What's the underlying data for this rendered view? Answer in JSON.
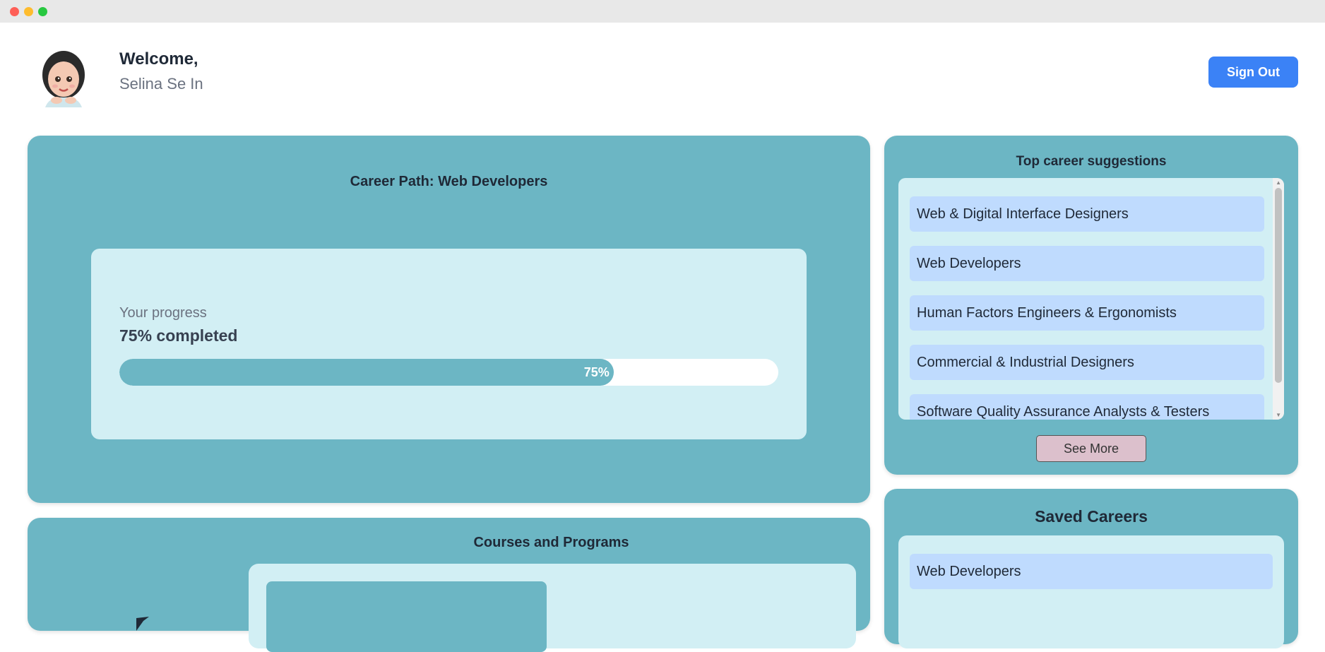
{
  "header": {
    "welcome": "Welcome,",
    "username": "Selina Se In",
    "sign_out_label": "Sign Out"
  },
  "career_path": {
    "title": "Career Path: Web Developers",
    "progress_label": "Your progress",
    "progress_value": "75% completed",
    "progress_badge": "75%",
    "progress_fraction": 0.75
  },
  "suggestions": {
    "title": "Top career suggestions",
    "items": [
      {
        "label": "Web & Digital Interface Designers"
      },
      {
        "label": "Web Developers"
      },
      {
        "label": "Human Factors Engineers & Ergonomists"
      },
      {
        "label": "Commercial & Industrial Designers"
      },
      {
        "label": "Software Quality Assurance Analysts & Testers"
      }
    ],
    "see_more_label": "See More"
  },
  "courses": {
    "title": "Courses and Programs"
  },
  "saved_careers": {
    "title": "Saved Careers",
    "items": [
      {
        "label": "Web Developers"
      }
    ]
  },
  "colors": {
    "card_bg": "#6cb6c4",
    "panel_bg": "#d2eff4",
    "item_bg": "#bfdbfe",
    "accent": "#3b82f6"
  },
  "icons": {
    "avatar": "memoji-avatar",
    "courses_marker": "flag-icon"
  }
}
